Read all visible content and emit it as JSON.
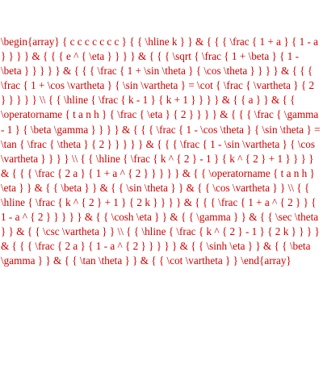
{
  "document": {
    "text_color": "#cc0000",
    "background_color": "#ffffff",
    "latex_source": "\\begin{array} { c c c c c c c } { { \\hline k } } & { { { \\frac { 1 + a } { 1 - a } } } } & { { { e ^ { \\eta } } } } & { { { \\sqrt { \\frac { 1 + \\beta } { 1 - \\beta } } } } } & { { { \\frac { 1 + \\sin \\theta } { \\cos \\theta } } } } & { { { \\frac { 1 + \\cos \\vartheta } { \\sin \\vartheta } = \\cot { \\frac { \\vartheta } { 2 } } } } } \\\\ { { \\hline { \\frac { k - 1 } { k + 1 } } } } & { { a } } & { { \\operatorname { t a n h } { \\frac { \\eta } { 2 } } } } & { { { \\frac { \\gamma - 1 } { \\beta \\gamma } } } } & { { { \\frac { 1 - \\cos \\theta } { \\sin \\theta } = \\tan { \\frac { \\theta } { 2 } } } } } & { { { \\frac { 1 - \\sin \\vartheta } { \\cos \\vartheta } } } } \\\\ { { \\hline { \\frac { k ^ { 2 } - 1 } { k ^ { 2 } + 1 } } } } & { { { \\frac { 2 a } { 1 + a ^ { 2 } } } } } & { { \\operatorname { t a n h } \\eta } } & { { \\beta } } & { { \\sin \\theta } } & { { \\cos \\vartheta } } \\\\ { { \\hline { \\frac { k ^ { 2 } + 1 } { 2 k } } } } & { { { \\frac { 1 + a ^ { 2 } } { 1 - a ^ { 2 } } } } } & { { \\cosh \\eta } } & { { \\gamma } } & { { \\sec \\theta } } & { { \\csc \\vartheta } } \\\\ { { \\hline { \\frac { k ^ { 2 } - 1 } { 2 k } } } } & { { { \\frac { 2 a } { 1 - a ^ { 2 } } } } } & { { \\sinh \\eta } } & { { \\beta \\gamma } } & { { \\tan \\theta } } & { { \\cot \\vartheta } } \\end{array}"
  }
}
